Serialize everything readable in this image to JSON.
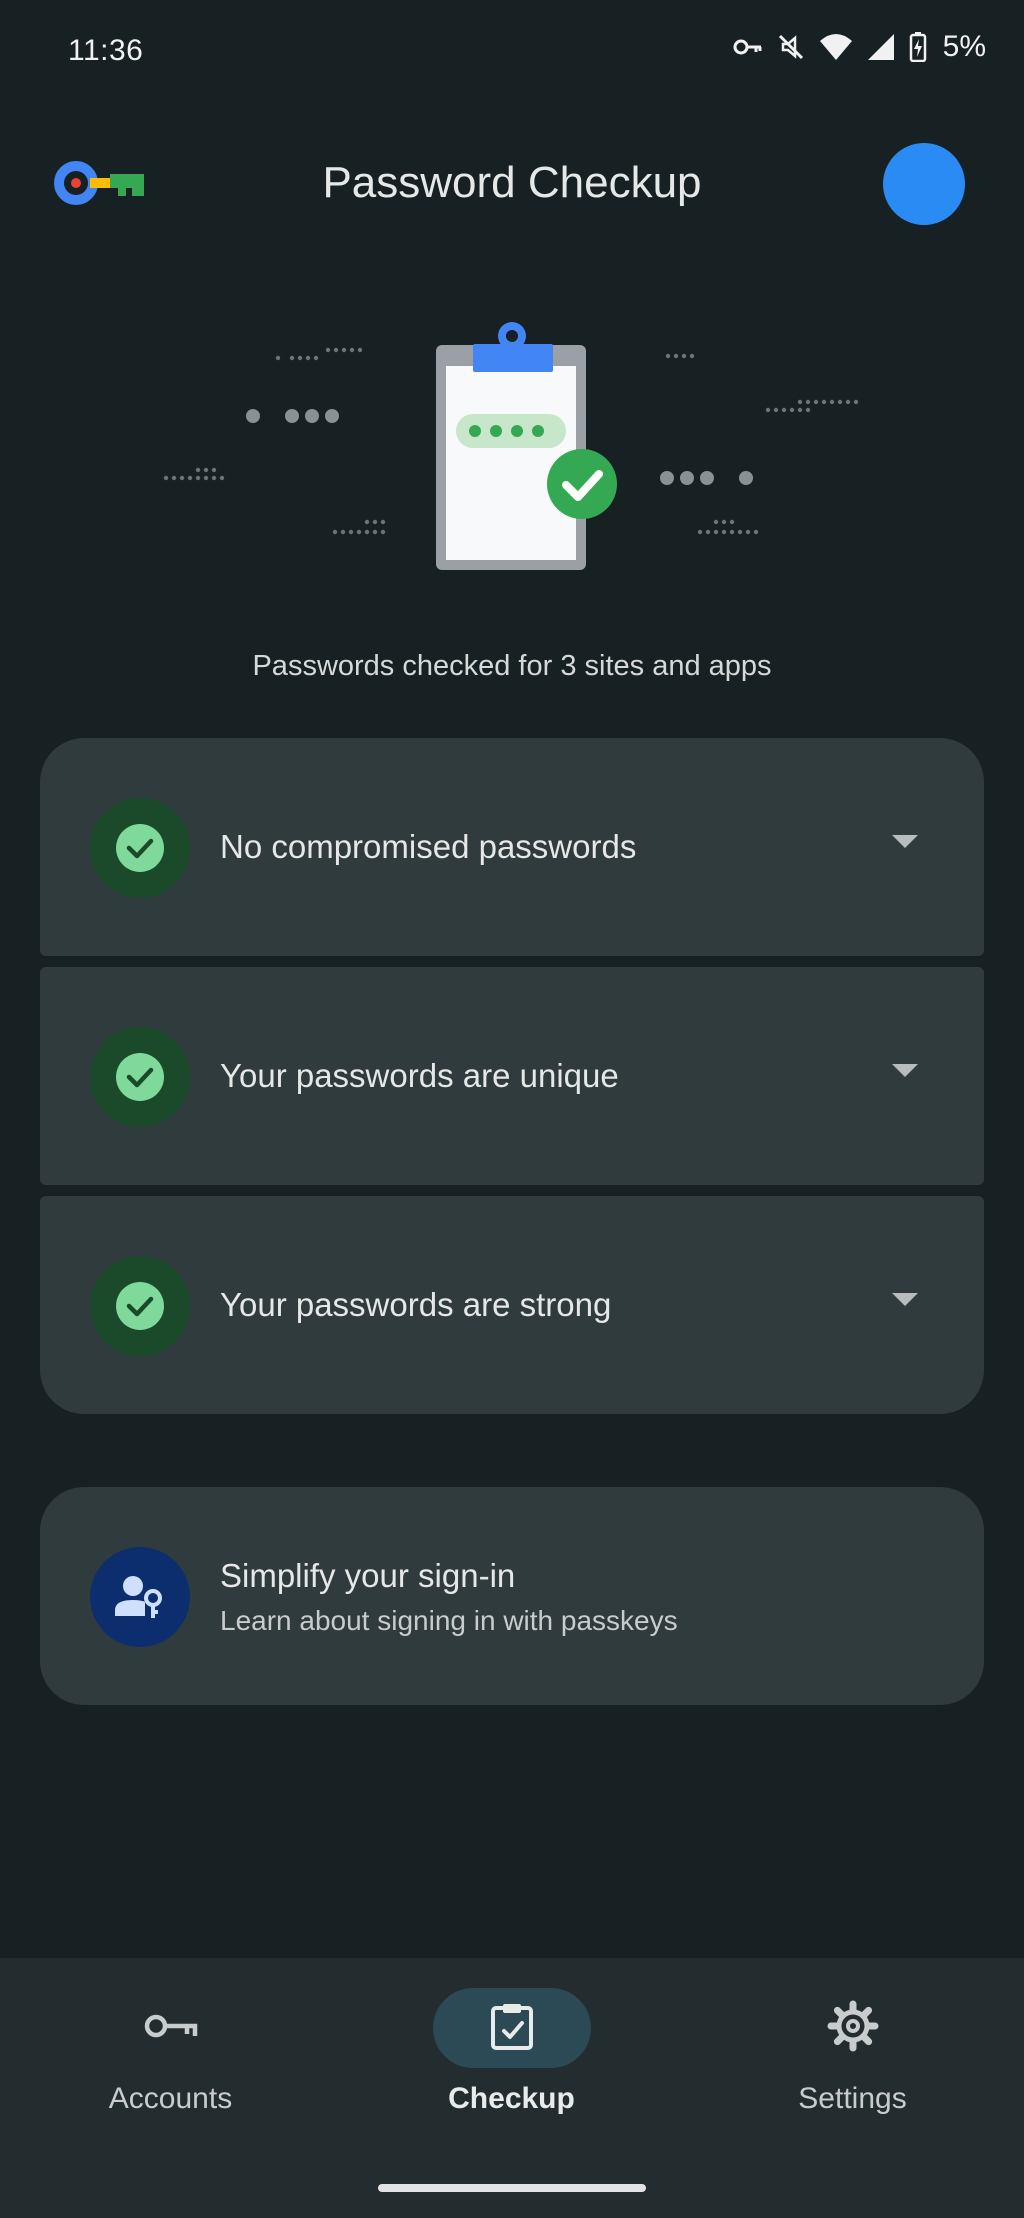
{
  "status_bar": {
    "time": "11:36",
    "battery": "5%",
    "icons": [
      "vpn-key-icon",
      "mute-icon",
      "wifi-icon",
      "signal-icon",
      "battery-charging-icon"
    ]
  },
  "header": {
    "title": "Password Checkup",
    "logo_icon": "password-manager-key-icon",
    "avatar_color": "#2b8bf5"
  },
  "summary": {
    "text": "Passwords checked for 3 sites and apps"
  },
  "checks": [
    {
      "label": "No compromised passwords",
      "icon": "check-circle-icon"
    },
    {
      "label": "Your passwords are unique",
      "icon": "check-circle-icon"
    },
    {
      "label": "Your passwords are strong",
      "icon": "check-circle-icon"
    }
  ],
  "passkey_card": {
    "title": "Simplify your sign-in",
    "subtitle": "Learn about signing in with passkeys",
    "icon": "person-key-icon"
  },
  "bottom_nav": {
    "items": [
      {
        "label": "Accounts",
        "icon": "key-icon",
        "active": false
      },
      {
        "label": "Checkup",
        "icon": "clipboard-check-icon",
        "active": true
      },
      {
        "label": "Settings",
        "icon": "gear-icon",
        "active": false
      }
    ]
  },
  "colors": {
    "background": "#172023",
    "card": "#2f3b3d",
    "check_green": "#7fd99a",
    "accent_blue": "#2b8bf5"
  }
}
